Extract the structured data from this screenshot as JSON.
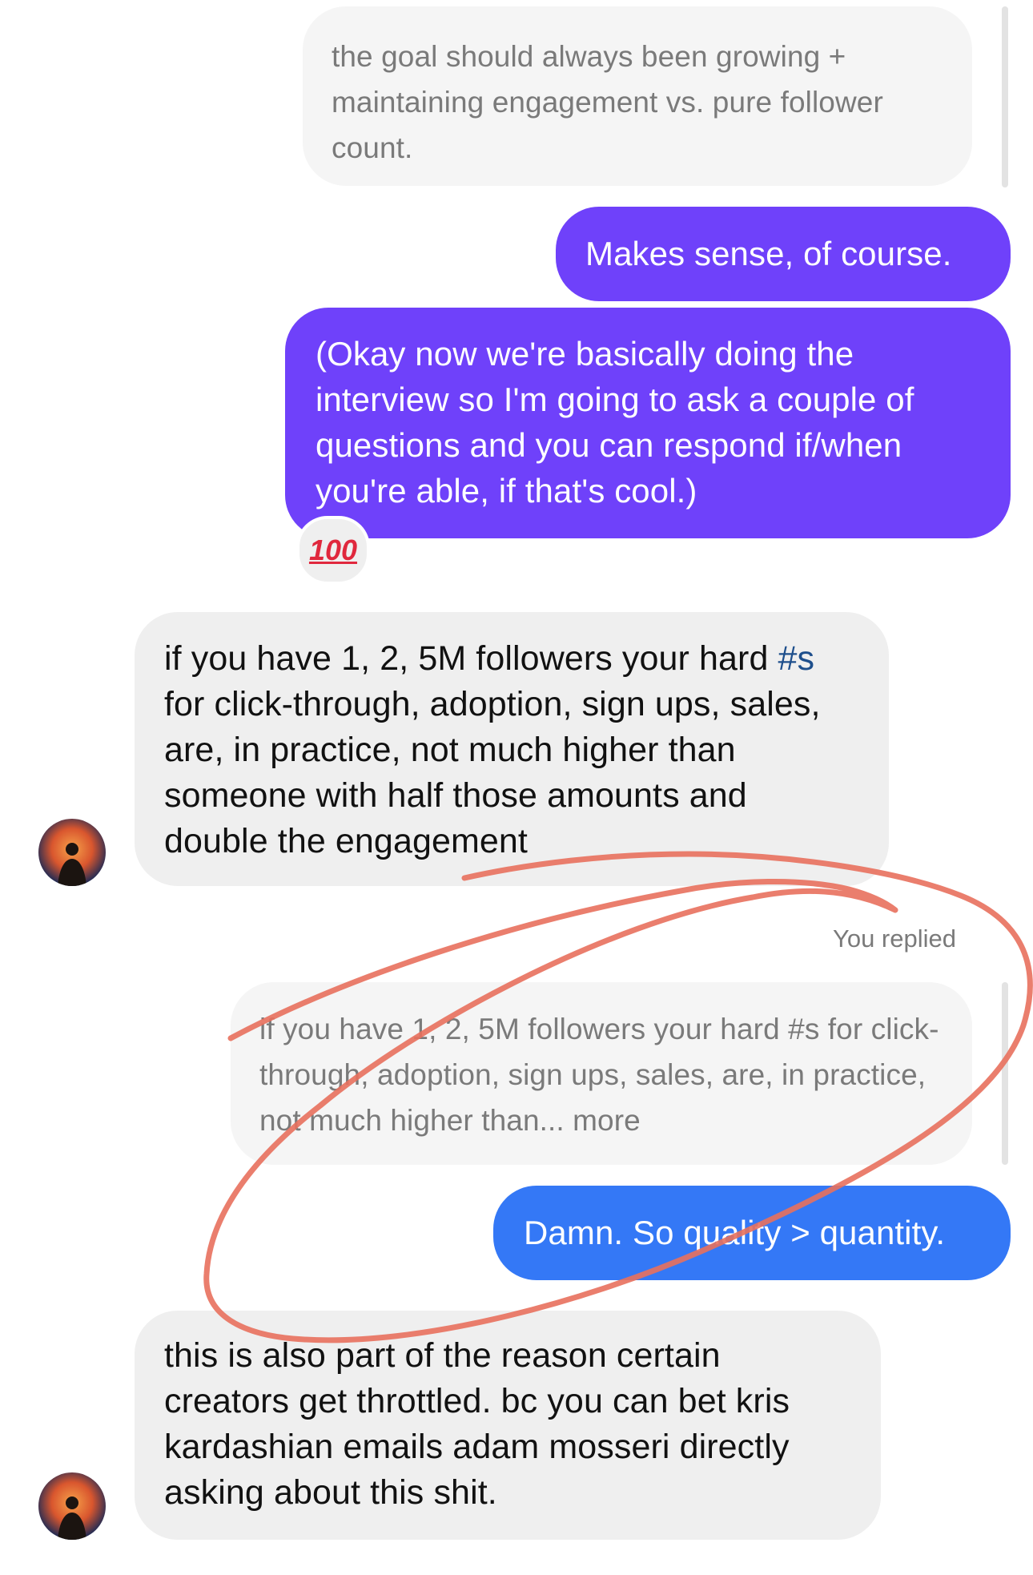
{
  "thread": {
    "messages": [
      {
        "kind": "reply-quote",
        "text": "the goal should always been growing + maintaining engagement vs. pure follower count."
      },
      {
        "kind": "outgoing",
        "text": "Makes sense, of course."
      },
      {
        "kind": "outgoing",
        "text": "(Okay now we're basically doing the interview so I'm going to ask a couple of questions and you can respond if/when you're able, if that's cool.)",
        "reaction": "100"
      },
      {
        "kind": "incoming",
        "text_before_tag": "if you have 1, 2, 5M followers your hard ",
        "hashtag": "#s",
        "text_after_tag": " for click-through, adoption, sign ups, sales, are, in practice, not much higher than someone with half those amounts and double the engagement"
      },
      {
        "kind": "meta",
        "text": "You replied"
      },
      {
        "kind": "reply-quote",
        "text": "if you have 1, 2, 5M followers your hard #s for click-through, adoption, sign ups, sales, are, in practice, not much higher than... more"
      },
      {
        "kind": "outgoing",
        "text": "Damn. So quality > quantity."
      },
      {
        "kind": "incoming",
        "text": "this is also part of the reason certain creators get throttled. bc you can bet kris kardashian emails adam mosseri directly asking about this shit."
      }
    ]
  },
  "colors": {
    "outgoing_purple": "#6f41fa",
    "outgoing_blue": "#3478f6",
    "incoming_bg": "#efefef",
    "quote_bg": "#f5f5f5",
    "annotation": "#e8705d"
  },
  "icons": {
    "reaction": "hundred-points-emoji",
    "avatar": "contact-avatar"
  }
}
